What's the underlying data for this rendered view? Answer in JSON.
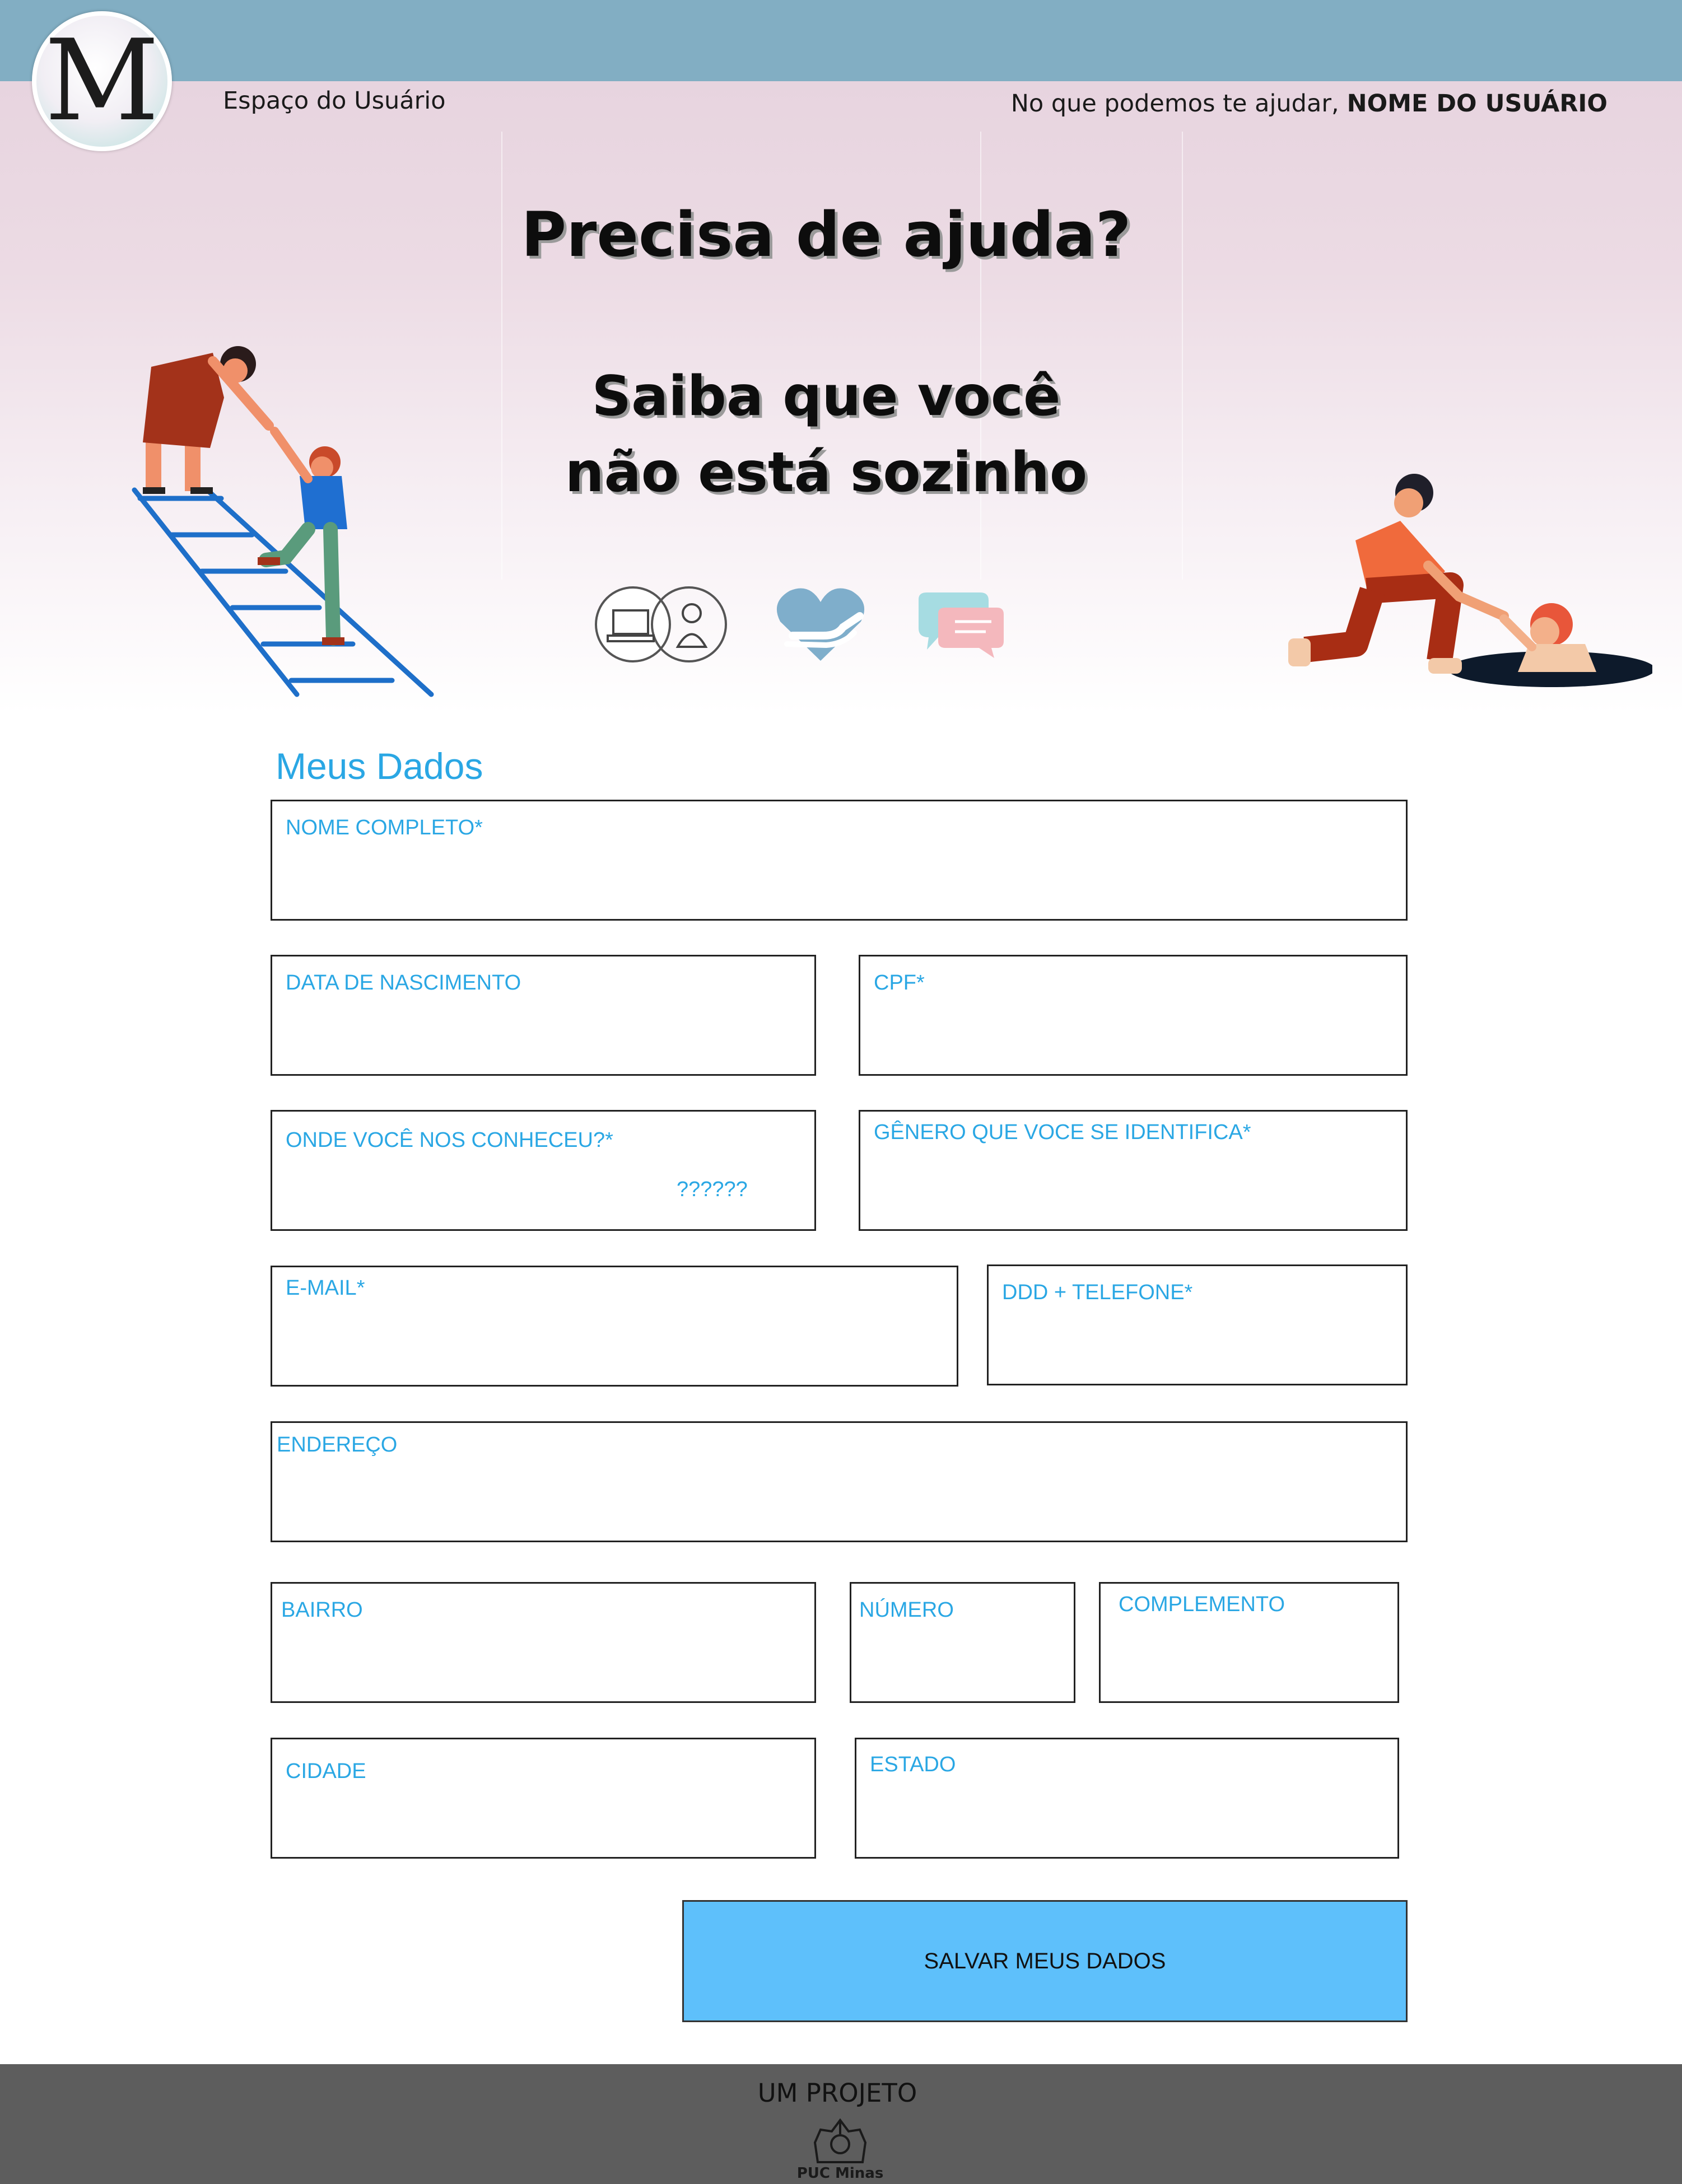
{
  "header": {
    "logo_letter": "M",
    "user_space": "Espaço do Usuário",
    "greeting_prefix": "No que podemos te ajudar,",
    "user_name": "NOME DO USUÁRIO"
  },
  "hero": {
    "title": "Precisa de ajuda?",
    "subtitle_line1": "Saiba que você",
    "subtitle_line2": "não está sozinho",
    "icons": [
      "online-therapy-icon",
      "heart-hands-icon",
      "chat-bubbles-icon"
    ],
    "illustrations": [
      "ladder-help-illustration",
      "hole-rescue-illustration"
    ]
  },
  "form": {
    "section_title": "Meus Dados",
    "fields": {
      "full_name": "NOME COMPLETO*",
      "birth_date": "DATA DE NASCIMENTO",
      "cpf": "CPF*",
      "referral": "ONDE VOCÊ NOS CONHECEU?*",
      "referral_value": "??????",
      "gender": "GÊNERO QUE VOCE SE IDENTIFICA*",
      "email": "E-MAIL*",
      "phone": "DDD + TELEFONE*",
      "address": "ENDEREÇO",
      "district": "BAIRRO",
      "number": "NÚMERO",
      "complement": "COMPLEMENTO",
      "city": "CIDADE",
      "state": "ESTADO"
    },
    "save_label": "SALVAR MEUS DADOS"
  },
  "footer": {
    "text": "UM PROJETO",
    "institution": "PUC Minas"
  },
  "colors": {
    "topbar": "#82aec3",
    "accent_label": "#2aa7e4",
    "save_button": "#5ec0fb",
    "footer": "#5d5d5d"
  }
}
